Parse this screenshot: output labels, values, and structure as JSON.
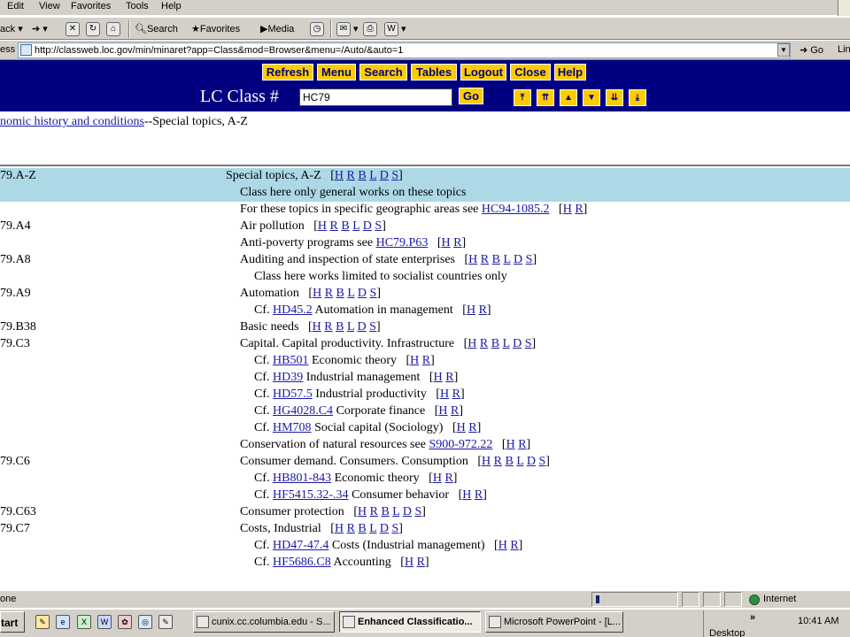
{
  "menubar": {
    "items": [
      "Edit",
      "View",
      "Favorites",
      "Tools",
      "Help"
    ]
  },
  "toolbar": {
    "back": "ack",
    "search": "Search",
    "favorites": "Favorites",
    "media": "Media"
  },
  "address": {
    "label": "ess",
    "url": "http://classweb.loc.gov/min/minaret?app=Class&mod=Browser&menu=/Auto/&auto=1",
    "go": "Go",
    "links": "Lin"
  },
  "nav": {
    "buttons": [
      "Refresh",
      "Menu",
      "Search",
      "Tables",
      "Logout",
      "Close",
      "Help"
    ],
    "lc_label": "LC Class #",
    "lc_value": "HC79",
    "go": "Go"
  },
  "breadcrumb": {
    "link": "nomic history and conditions",
    "text": "--Special topics, A-Z"
  },
  "rows": [
    {
      "cls": "79.A-Z",
      "indent": 0,
      "text": "Special topics, A-Z",
      "links": [
        "H",
        "R",
        "B",
        "L",
        "D",
        "S"
      ],
      "highlight": true
    },
    {
      "cls": "",
      "indent": 1,
      "text": "Class here only general works on these topics",
      "links": [],
      "highlight": true
    },
    {
      "cls": "",
      "indent": 1,
      "text": "For these topics in specific geographic areas see ",
      "ref": "HC94-1085.2",
      "links": [
        "H",
        "R"
      ]
    },
    {
      "cls": "79.A4",
      "indent": 1,
      "text": "Air pollution",
      "links": [
        "H",
        "R",
        "B",
        "L",
        "D",
        "S"
      ]
    },
    {
      "cls": "",
      "indent": 1,
      "text": "Anti-poverty programs see ",
      "ref": "HC79.P63",
      "links": [
        "H",
        "R"
      ]
    },
    {
      "cls": "79.A8",
      "indent": 1,
      "text": "Auditing and inspection of state enterprises",
      "links": [
        "H",
        "R",
        "B",
        "L",
        "D",
        "S"
      ]
    },
    {
      "cls": "",
      "indent": 2,
      "text": "Class here works limited to socialist countries only",
      "links": []
    },
    {
      "cls": "79.A9",
      "indent": 1,
      "text": "Automation",
      "links": [
        "H",
        "R",
        "B",
        "L",
        "D",
        "S"
      ]
    },
    {
      "cls": "",
      "indent": 2,
      "text": "Cf. ",
      "ref": "HD45.2",
      "after": " Automation in management",
      "links": [
        "H",
        "R"
      ]
    },
    {
      "cls": "79.B38",
      "indent": 1,
      "text": "Basic needs",
      "links": [
        "H",
        "R",
        "B",
        "L",
        "D",
        "S"
      ]
    },
    {
      "cls": "79.C3",
      "indent": 1,
      "text": "Capital. Capital productivity. Infrastructure",
      "links": [
        "H",
        "R",
        "B",
        "L",
        "D",
        "S"
      ]
    },
    {
      "cls": "",
      "indent": 2,
      "text": "Cf. ",
      "ref": "HB501",
      "after": " Economic theory",
      "links": [
        "H",
        "R"
      ]
    },
    {
      "cls": "",
      "indent": 2,
      "text": "Cf. ",
      "ref": "HD39",
      "after": " Industrial management",
      "links": [
        "H",
        "R"
      ]
    },
    {
      "cls": "",
      "indent": 2,
      "text": "Cf. ",
      "ref": "HD57.5",
      "after": " Industrial productivity",
      "links": [
        "H",
        "R"
      ]
    },
    {
      "cls": "",
      "indent": 2,
      "text": "Cf. ",
      "ref": "HG4028.C4",
      "after": " Corporate finance",
      "links": [
        "H",
        "R"
      ]
    },
    {
      "cls": "",
      "indent": 2,
      "text": "Cf. ",
      "ref": "HM708",
      "after": " Social capital (Sociology)",
      "links": [
        "H",
        "R"
      ]
    },
    {
      "cls": "",
      "indent": 1,
      "text": "Conservation of natural resources see ",
      "ref": "S900-972.22",
      "links": [
        "H",
        "R"
      ]
    },
    {
      "cls": "79.C6",
      "indent": 1,
      "text": "Consumer demand. Consumers. Consumption",
      "links": [
        "H",
        "R",
        "B",
        "L",
        "D",
        "S"
      ]
    },
    {
      "cls": "",
      "indent": 2,
      "text": "Cf. ",
      "ref": "HB801-843",
      "after": " Economic theory",
      "links": [
        "H",
        "R"
      ]
    },
    {
      "cls": "",
      "indent": 2,
      "text": "Cf. ",
      "ref": "HF5415.32-.34",
      "after": " Consumer behavior",
      "links": [
        "H",
        "R"
      ]
    },
    {
      "cls": "79.C63",
      "indent": 1,
      "text": "Consumer protection",
      "links": [
        "H",
        "R",
        "B",
        "L",
        "D",
        "S"
      ]
    },
    {
      "cls": "79.C7",
      "indent": 1,
      "text": "Costs, Industrial",
      "links": [
        "H",
        "R",
        "B",
        "L",
        "D",
        "S"
      ]
    },
    {
      "cls": "",
      "indent": 2,
      "text": "Cf. ",
      "ref": "HD47-47.4",
      "after": " Costs (Industrial management)",
      "links": [
        "H",
        "R"
      ]
    },
    {
      "cls": "",
      "indent": 2,
      "text": "Cf. ",
      "ref": "HF5686.C8",
      "after": " Accounting",
      "links": [
        "H",
        "R"
      ]
    }
  ],
  "status": {
    "left": "one",
    "zone": "Internet"
  },
  "taskbar": {
    "start": "tart",
    "tasks": [
      {
        "label": "cunix.cc.columbia.edu - S...",
        "active": false
      },
      {
        "label": "Enhanced Classificatio...",
        "active": true
      },
      {
        "label": "Microsoft PowerPoint - [L...",
        "active": false
      }
    ],
    "desktop": "Desktop",
    "clock": "10:41 AM"
  },
  "colors": {
    "banner": "#000080",
    "button": "#ffcc00",
    "highlight": "#add8e6",
    "link": "#1a1aa6"
  }
}
